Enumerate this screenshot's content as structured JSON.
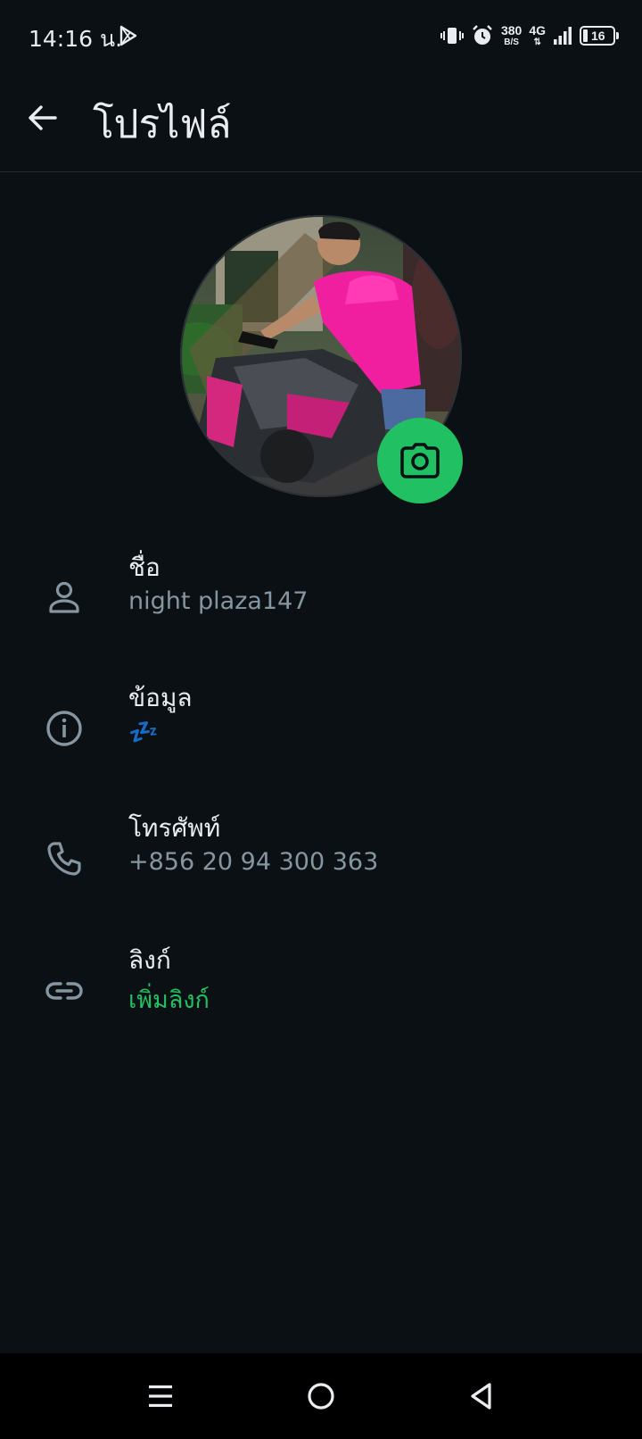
{
  "status_bar": {
    "time": "14:16 น.",
    "net_speed_value": "380",
    "net_speed_unit": "B/S",
    "network_type": "4G",
    "battery": "16",
    "icons": [
      "play-store-icon",
      "vibrate-icon",
      "alarm-icon",
      "signal-icon",
      "battery-icon"
    ]
  },
  "app_bar": {
    "title": "โปรไฟล์",
    "back_icon": "arrow-left-icon"
  },
  "profile": {
    "camera_icon": "camera-icon",
    "rows": [
      {
        "icon": "person-icon",
        "label": "ชื่อ",
        "value": "night plaza147"
      },
      {
        "icon": "info-icon",
        "label": "ข้อมูล",
        "value": "💤"
      },
      {
        "icon": "phone-icon",
        "label": "โทรศัพท์",
        "value": "+856 20 94 300 363"
      },
      {
        "icon": "link-icon",
        "label": "ลิงก์",
        "value": "เพิ่มลิงก์"
      }
    ]
  },
  "colors": {
    "background": "#0b1014",
    "accent": "#21c063",
    "secondary_text": "#8696a0",
    "icon": "#8696a0"
  },
  "nav_bar": {
    "icons": [
      "menu-icon",
      "home-icon",
      "back-triangle-icon"
    ]
  }
}
